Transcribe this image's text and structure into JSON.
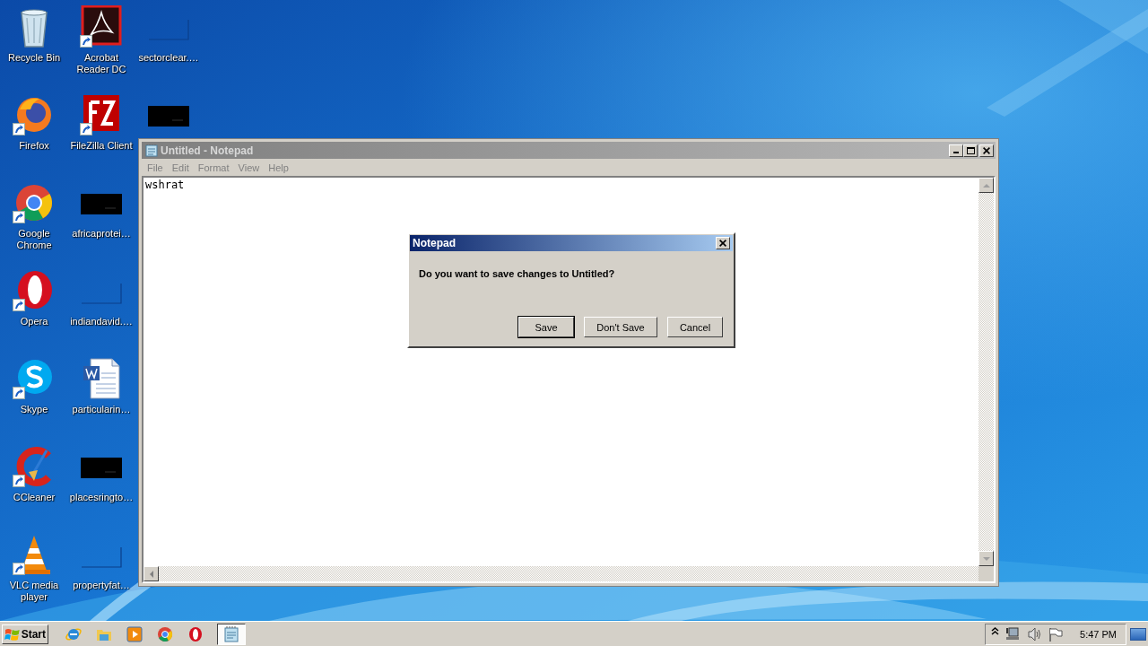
{
  "desktop": {
    "icons": [
      {
        "kind": "recycle",
        "label": "Recycle Bin",
        "shortcut": false
      },
      {
        "kind": "firefox",
        "label": "Firefox",
        "shortcut": true
      },
      {
        "kind": "chrome",
        "label": "Google Chrome",
        "shortcut": true
      },
      {
        "kind": "opera",
        "label": "Opera",
        "shortcut": true
      },
      {
        "kind": "skype",
        "label": "Skype",
        "shortcut": true
      },
      {
        "kind": "ccleaner",
        "label": "CCleaner",
        "shortcut": true
      },
      {
        "kind": "vlc",
        "label": "VLC media player",
        "shortcut": true
      },
      {
        "kind": "acrobat",
        "label": "Acrobat Reader DC",
        "shortcut": true
      },
      {
        "kind": "filezilla",
        "label": "FileZilla Client",
        "shortcut": true
      },
      {
        "kind": "redacted",
        "label": "africaprotei…",
        "shortcut": false
      },
      {
        "kind": "blank",
        "label": "indiandavid.…",
        "shortcut": false
      },
      {
        "kind": "word",
        "label": "particularin…",
        "shortcut": false
      },
      {
        "kind": "redacted",
        "label": "placesringto…",
        "shortcut": false
      },
      {
        "kind": "blank",
        "label": "propertyfat…",
        "shortcut": false
      },
      {
        "kind": "blank",
        "label": "sectorclear.…",
        "shortcut": false
      },
      {
        "kind": "redacted",
        "shortcut": false
      }
    ]
  },
  "notepad": {
    "title": "Untitled - Notepad",
    "active": false,
    "menu": [
      "File",
      "Edit",
      "Format",
      "View",
      "Help"
    ],
    "text": "wshrat"
  },
  "dialog": {
    "title": "Notepad",
    "message": "Do you want to save changes to Untitled?",
    "buttons": [
      {
        "label": "Save",
        "default": true
      },
      {
        "label": "Don't Save",
        "default": false
      },
      {
        "label": "Cancel",
        "default": false
      }
    ]
  },
  "taskbar": {
    "start": "Start",
    "quick_launch": [
      {
        "kind": "ie"
      },
      {
        "kind": "explorer"
      },
      {
        "kind": "media"
      },
      {
        "kind": "chrome"
      },
      {
        "kind": "opera"
      }
    ],
    "tasks": [
      {
        "kind": "notepad",
        "selected": true
      }
    ],
    "tray": [
      {
        "kind": "chevron"
      },
      {
        "kind": "network"
      },
      {
        "kind": "speaker"
      },
      {
        "kind": "flag"
      }
    ],
    "clock": "5:47 PM"
  }
}
